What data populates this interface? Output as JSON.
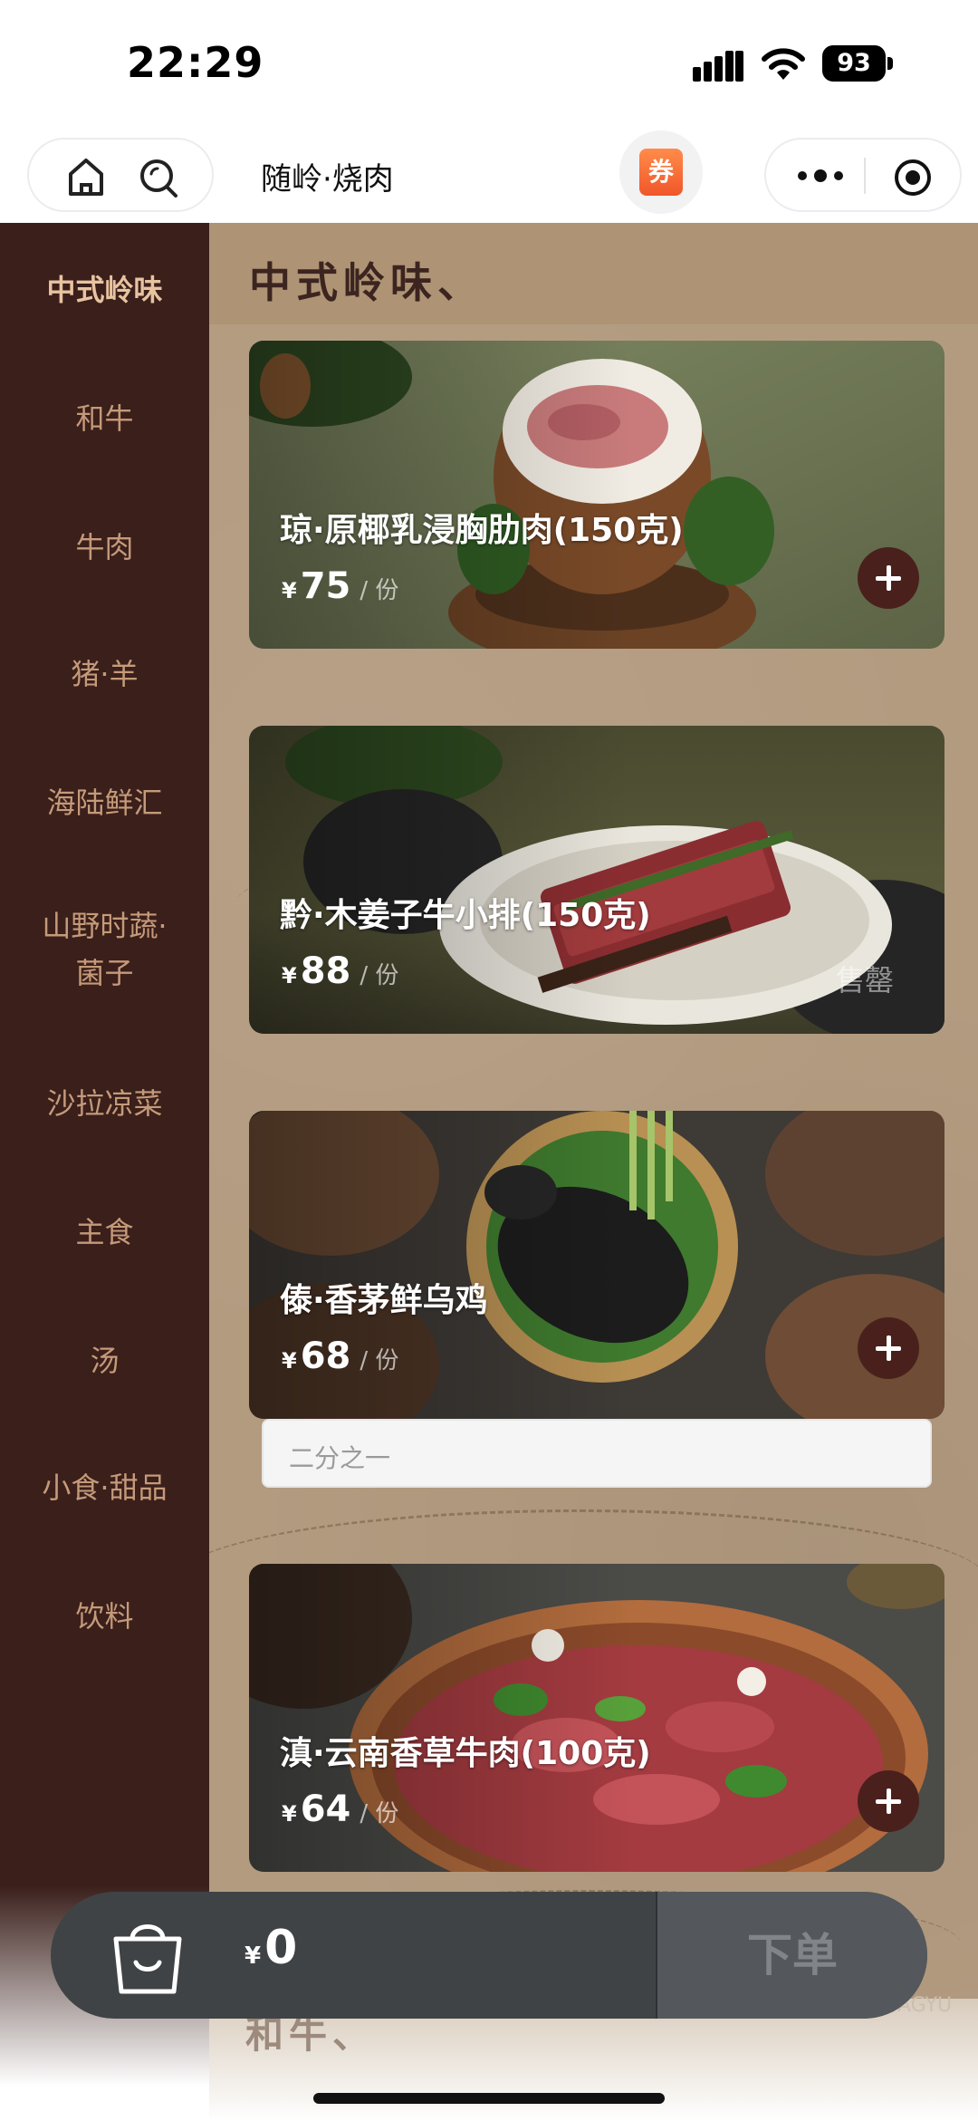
{
  "status_bar": {
    "time": "22:29",
    "battery": "93"
  },
  "nav": {
    "title": "随岭·烧肉",
    "coupon_label": "券"
  },
  "sidebar": {
    "items": [
      {
        "label": "中式岭味",
        "active": true
      },
      {
        "label": "和牛"
      },
      {
        "label": "牛肉"
      },
      {
        "label": "猪·羊"
      },
      {
        "label": "海陆鲜汇"
      },
      {
        "label": "山野时蔬·\n菌子"
      },
      {
        "label": "沙拉凉菜"
      },
      {
        "label": "主食"
      },
      {
        "label": "汤"
      },
      {
        "label": "小食·甜品"
      },
      {
        "label": "饮料"
      }
    ]
  },
  "main": {
    "section_title": "中式岭味、",
    "next_section_title": "和牛、",
    "brand_mark": "AGYU",
    "products": [
      {
        "name": "琼·原椰乳浸胸肋肉(150克)",
        "currency": "¥",
        "price": "75",
        "unit": "/ 份",
        "status": "add"
      },
      {
        "name": "黔·木姜子牛小排(150克)",
        "currency": "¥",
        "price": "88",
        "unit": "/ 份",
        "status": "售罄"
      },
      {
        "name": "傣·香茅鲜乌鸡",
        "currency": "¥",
        "price": "68",
        "unit": "/ 份",
        "status": "add",
        "spec": "二分之一"
      },
      {
        "name": "滇·云南香草牛肉(100克)",
        "currency": "¥",
        "price": "64",
        "unit": "/ 份",
        "status": "add"
      }
    ]
  },
  "cart": {
    "currency": "¥",
    "total": "0",
    "checkout_label": "下单"
  },
  "colors": {
    "sidebar_bg": "#3a1f1b",
    "sidebar_text": "#c59a79",
    "paper_bg": "#b39b80",
    "add_button": "#4a201c",
    "cart_bar": "#3f4346"
  }
}
